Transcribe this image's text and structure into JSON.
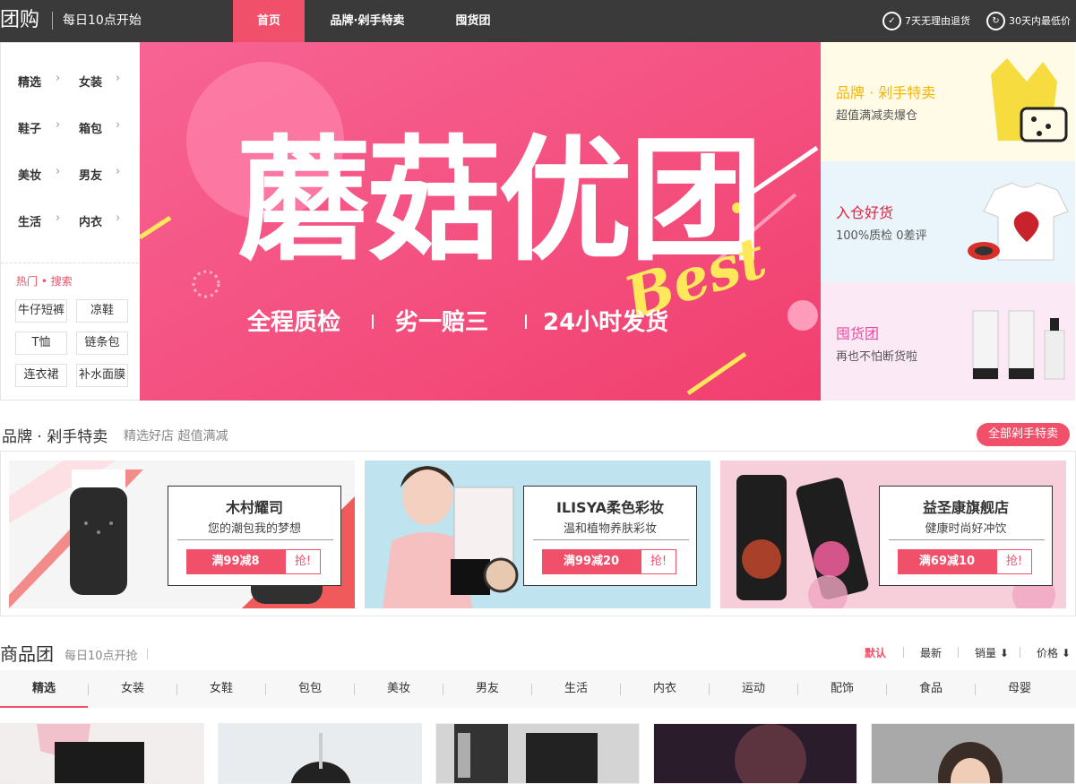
{
  "topbar": {
    "brand": "团购",
    "slogan": "每日10点开始",
    "nav": [
      "首页",
      "品牌·剁手特卖",
      "囤货团"
    ],
    "promises": [
      "7天无理由退货",
      "30天内最低价"
    ]
  },
  "sidebar": {
    "categories": [
      [
        "精选",
        "女装"
      ],
      [
        "鞋子",
        "箱包"
      ],
      [
        "美妆",
        "男友"
      ],
      [
        "生活",
        "内衣"
      ]
    ],
    "hot_title": "热门 • 搜索",
    "hot_tags": [
      "牛仔短裤",
      "凉鞋",
      "T恤",
      "链条包",
      "连衣裙",
      "补水面膜"
    ]
  },
  "banner": {
    "headline": "蘑菇优团",
    "script": "Best",
    "taglines": [
      "全程质检",
      "劣一赔三",
      "24小时发货"
    ]
  },
  "promos": [
    {
      "title": "品牌 · 剁手特卖",
      "sub": "超值满减卖爆仓",
      "color": "#f7b500"
    },
    {
      "title": "入仓好货",
      "sub": "100%质检 0差评",
      "color": "#e0243c"
    },
    {
      "title": "囤货团",
      "sub": "再也不怕断货啦",
      "color": "#e84c9b"
    }
  ],
  "brand_section": {
    "title": "品牌 · 剁手特卖",
    "subtitle": "精选好店 超值满减",
    "all_button": "全部剁手特卖",
    "cards": [
      {
        "name": "木村耀司",
        "slogan": "您的潮包我的梦想",
        "deal": "满99减8",
        "grab": "抢!"
      },
      {
        "name": "ILISYA柔色彩妆",
        "slogan": "温和植物养肤彩妆",
        "deal": "满99减20",
        "grab": "抢!"
      },
      {
        "name": "益圣康旗舰店",
        "slogan": "健康时尚好冲饮",
        "deal": "满69减10",
        "grab": "抢!"
      }
    ]
  },
  "goods_section": {
    "title": "商品团",
    "subtitle": "每日10点开抢",
    "sort": [
      "默认",
      "最新",
      "销量 ⬇",
      "价格 ⬇"
    ],
    "tabs": [
      "精选",
      "女装",
      "女鞋",
      "包包",
      "美妆",
      "男友",
      "生活",
      "内衣",
      "运动",
      "配饰",
      "食品",
      "母婴"
    ]
  },
  "colors": {
    "accent": "#f0506a",
    "topbar": "#3a3a3a"
  }
}
